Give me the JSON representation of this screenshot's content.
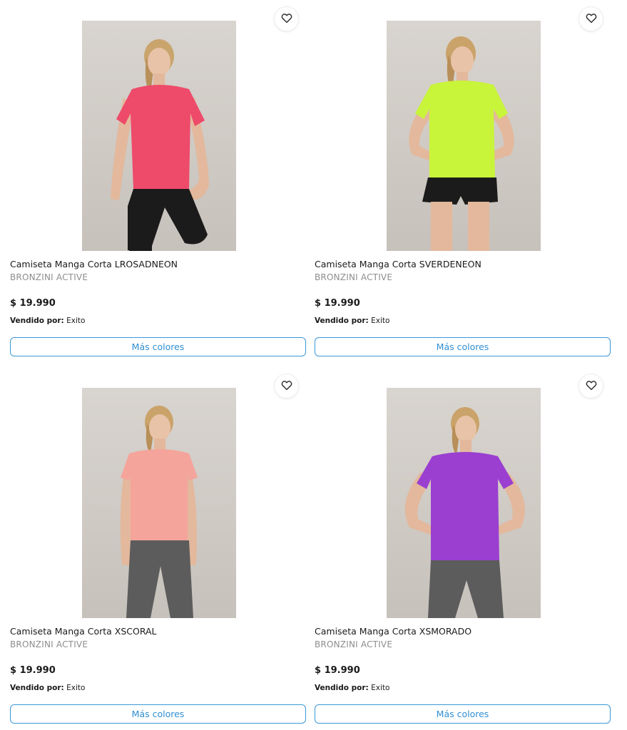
{
  "products": [
    {
      "title": "Camiseta Manga Corta LROSADNEON",
      "brand": "BRONZINI ACTIVE",
      "price": "$ 19.990",
      "seller_label": "Vendido por:",
      "seller": "Exito",
      "colors_button": "Más colores",
      "shirt_color": "#ee4a6a",
      "bottom_color": "#1b1b1b",
      "icon": "heart-outline"
    },
    {
      "title": "Camiseta Manga Corta SVERDENEON",
      "brand": "BRONZINI ACTIVE",
      "price": "$ 19.990",
      "seller_label": "Vendido por:",
      "seller": "Exito",
      "colors_button": "Más colores",
      "shirt_color": "#c8f43a",
      "bottom_color": "#1b1b1b",
      "icon": "heart-outline"
    },
    {
      "title": "Camiseta Manga Corta XSCORAL",
      "brand": "BRONZINI ACTIVE",
      "price": "$ 19.990",
      "seller_label": "Vendido por:",
      "seller": "Exito",
      "colors_button": "Más colores",
      "shirt_color": "#f4a49a",
      "bottom_color": "#5c5c5c",
      "icon": "heart-outline"
    },
    {
      "title": "Camiseta Manga Corta XSMORADO",
      "brand": "BRONZINI ACTIVE",
      "price": "$ 19.990",
      "seller_label": "Vendido por:",
      "seller": "Exito",
      "colors_button": "Más colores",
      "shirt_color": "#9a3fd0",
      "bottom_color": "#5c5c5c",
      "icon": "heart-outline"
    }
  ],
  "accent_color": "#2f8fd3"
}
